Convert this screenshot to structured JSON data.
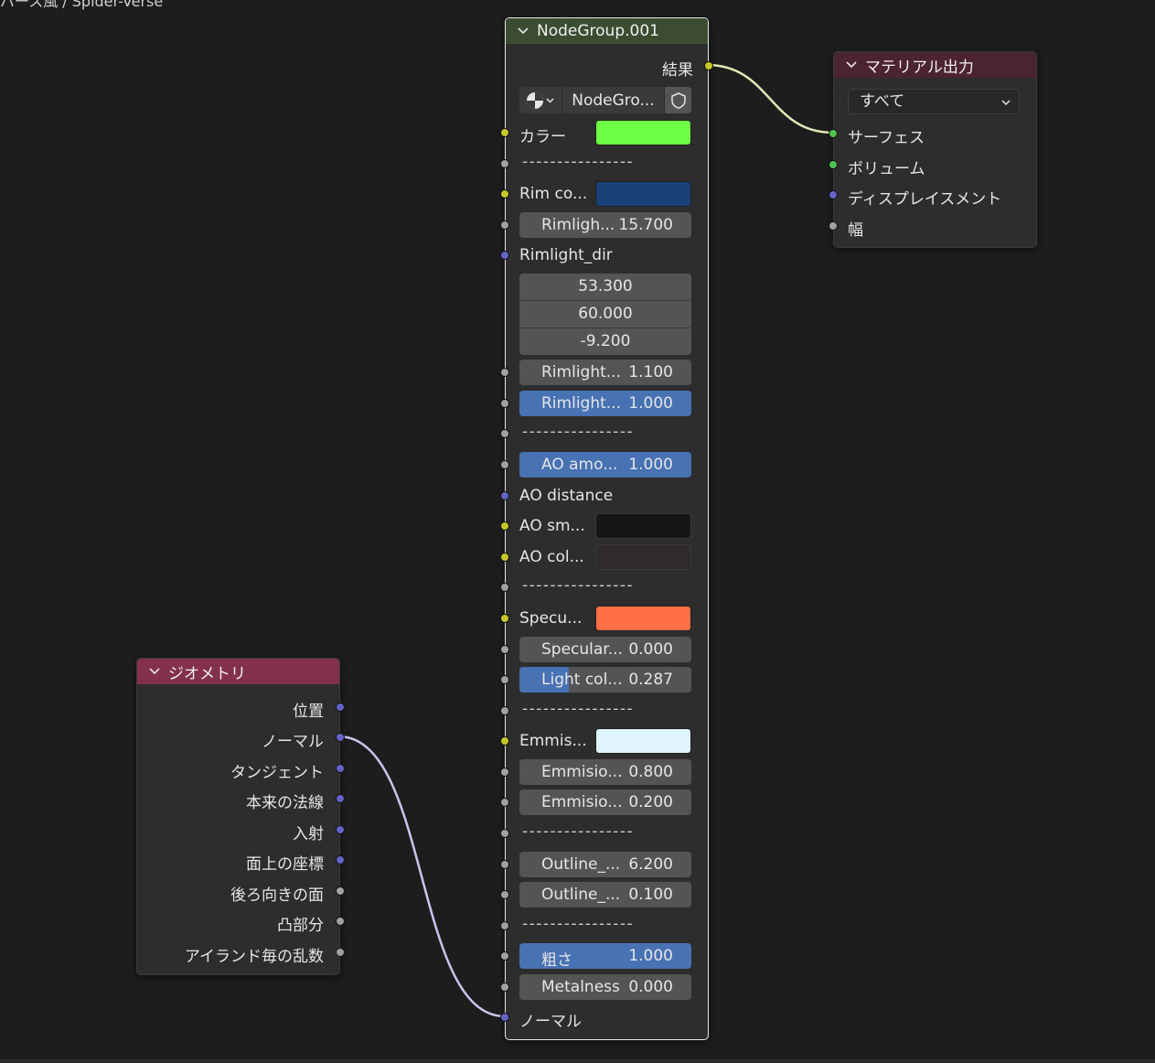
{
  "breadcrumb": "バース風 / Spider-Verse",
  "colors": {
    "group_header": "#3c4c31",
    "output_header": "#4c2330",
    "geometry_header": "#83314a",
    "socket_yellow": "#c7c729",
    "socket_grey": "#a1a1a1",
    "socket_purple": "#6363c7",
    "socket_green": "#4fc24f",
    "field_bg": "#545454",
    "field_active": "#4772b3",
    "link_normal": "#c8c4ee",
    "link_result": "#dfe8b7"
  },
  "group_node": {
    "title": "NodeGroup.001",
    "output_label": "結果",
    "datablock_name": "NodeGro...",
    "datablock_icon": "node-tree-icon",
    "separator": "----------------",
    "inputs": {
      "color_label": "カラー",
      "color_value": "#6cff43",
      "rim_color_label": "Rim co...",
      "rim_color_value": "#1b4179",
      "rim_light_name": "Rimligh...",
      "rim_light_value": "15.700",
      "rim_dir_label": "Rimlight_dir",
      "rim_dir_x": "53.300",
      "rim_dir_y": "60.000",
      "rim_dir_z": "-9.200",
      "rim_a_name": "Rimlight...",
      "rim_a_value": "1.100",
      "rim_b_name": "Rimlight...",
      "rim_b_value": "1.000",
      "ao_amount_name": "AO amo...",
      "ao_amount_value": "1.000",
      "ao_distance_label": "AO distance",
      "ao_smooth_label": "AO sm...",
      "ao_smooth_value": "#161616",
      "ao_color_label": "AO col...",
      "ao_color_value": "#2e2a2d",
      "spec_color_label": "Specu...",
      "spec_color_value": "#ff6e45",
      "specular_name": "Specular...",
      "specular_value": "0.000",
      "light_col_name": "Light col...",
      "light_col_value": "0.287",
      "light_col_fraction": 0.287,
      "emis_color_label": "Emmis...",
      "emis_color_value": "#dff4ff",
      "emis_a_name": "Emmisio...",
      "emis_a_value": "0.800",
      "emis_b_name": "Emmisio...",
      "emis_b_value": "0.200",
      "outline_a_name": "Outline_...",
      "outline_a_value": "6.200",
      "outline_b_name": "Outline_...",
      "outline_b_value": "0.100",
      "roughness_name": "粗さ",
      "roughness_value": "1.000",
      "metalness_name": "Metalness",
      "metalness_value": "0.000",
      "normal_label": "ノーマル"
    }
  },
  "output_node": {
    "title": "マテリアル出力",
    "target": "すべて",
    "inputs": [
      "サーフェス",
      "ボリューム",
      "ディスプレイスメント",
      "幅"
    ]
  },
  "geometry_node": {
    "title": "ジオメトリ",
    "outputs": [
      "位置",
      "ノーマル",
      "タンジェント",
      "本来の法線",
      "入射",
      "面上の座標",
      "後ろ向きの面",
      "凸部分",
      "アイランド毎の乱数"
    ]
  }
}
